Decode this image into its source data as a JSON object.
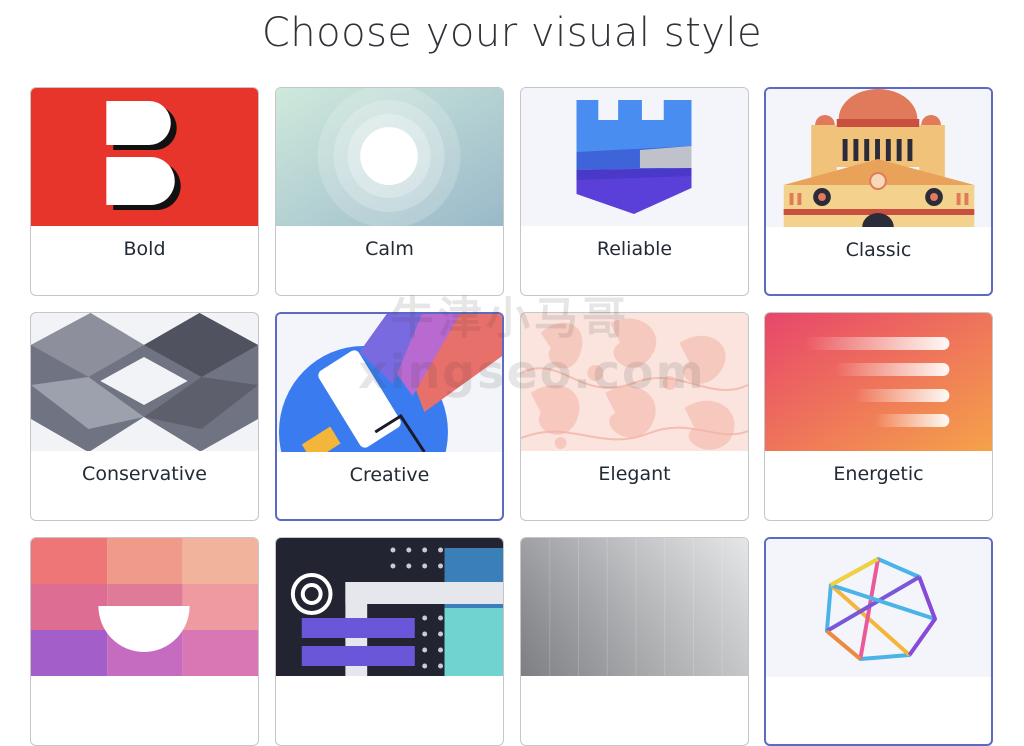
{
  "page": {
    "title": "Choose your visual style"
  },
  "styles": [
    {
      "label": "Bold",
      "selected": false
    },
    {
      "label": "Calm",
      "selected": false
    },
    {
      "label": "Reliable",
      "selected": false
    },
    {
      "label": "Classic",
      "selected": true
    },
    {
      "label": "Conservative",
      "selected": false
    },
    {
      "label": "Creative",
      "selected": true
    },
    {
      "label": "Elegant",
      "selected": false
    },
    {
      "label": "Energetic",
      "selected": false
    },
    {
      "label": "",
      "selected": false
    },
    {
      "label": "",
      "selected": false
    },
    {
      "label": "",
      "selected": false
    },
    {
      "label": "",
      "selected": true
    }
  ],
  "watermark": {
    "line1": "牛津小马哥",
    "line2": "xingseo.com"
  },
  "colors": {
    "accent": "#5c6ac4",
    "border": "#c4c6c8",
    "text": "#212b36"
  }
}
